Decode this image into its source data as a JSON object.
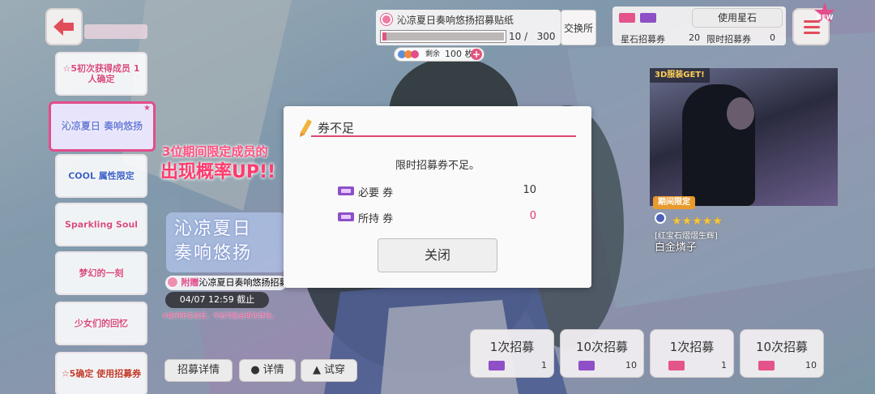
{
  "nav": {
    "back_icon": "arrow-left-icon",
    "menu_icon": "hamburger-menu-icon",
    "new_badge": "NEW"
  },
  "banners": [
    "☆5初次获得成员 1人确定",
    "沁凉夏日 奏响悠扬",
    "COOL 属性限定",
    "Sparkling Soul",
    "梦幻的一刻",
    "少女们的回忆",
    "☆5确定 使用招募券"
  ],
  "promo": {
    "line1": "3位期间限定成员的",
    "line2": "出现概率UP!!",
    "logo": "沁凉夏日\n奏响悠扬",
    "gift_prefix": "附赠",
    "gift_text": "沁凉夏日奏响悠扬招募贴",
    "deadline": "04/07 12:59 截止",
    "note": "※期间限定成员，今后可能会再次登场。"
  },
  "bottom_buttons": {
    "detail": "招募详情",
    "member_detail": "详情",
    "try_on": "试穿"
  },
  "event": {
    "title": "沁凉夏日奏响悠扬招募贴纸",
    "current": 10,
    "max": 300,
    "progress_text": "10 /   300",
    "exchange": "交换所",
    "remain_label": "剩余",
    "remain_value": "100 枚",
    "plus": "+"
  },
  "currency": {
    "use_star_stone": "使用星石",
    "star_ticket_label": "星石招募券",
    "star_ticket_count": "20",
    "limited_ticket_label": "限时招募券",
    "limited_ticket_count": "0",
    "colors": {
      "pink_ticket": "#e5538b",
      "purple_ticket": "#8e4fc7"
    }
  },
  "character": {
    "tag_3d": "3D服装GET!",
    "limited": "期间限定",
    "stars": "★★★★★",
    "card_name": "[红宝石熠熠生辉]",
    "member_name": "白金燐子"
  },
  "gacha_buttons": [
    {
      "label": "1次招募",
      "count": "1",
      "ticket": "pink"
    },
    {
      "label": "10次招募",
      "count": "10",
      "ticket": "pink"
    },
    {
      "label": "1次招募",
      "count": "1",
      "ticket": "pink"
    },
    {
      "label": "10次招募",
      "count": "10",
      "ticket": "pink"
    }
  ],
  "modal": {
    "title": "券不足",
    "message": "限时招募券不足。",
    "required_label": "必要 券",
    "required_value": "10",
    "owned_label": "所持 券",
    "owned_value": "0",
    "close": "关闭"
  }
}
